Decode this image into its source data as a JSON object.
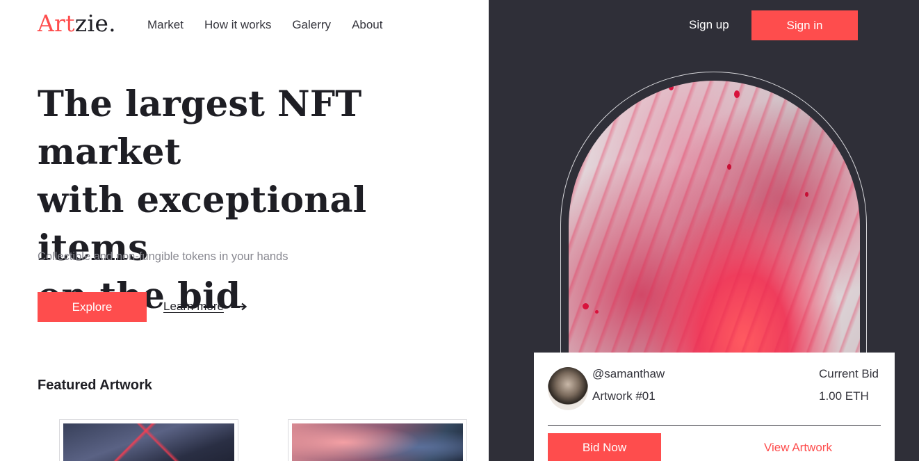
{
  "brand": {
    "logo_accent": "Art",
    "logo_rest": "zie."
  },
  "nav": {
    "items": [
      {
        "label": "Market"
      },
      {
        "label": "How it works"
      },
      {
        "label": "Galerry"
      },
      {
        "label": "About"
      }
    ]
  },
  "auth": {
    "signup_label": "Sign up",
    "signin_label": "Sign in"
  },
  "hero": {
    "title_line1": "The largest NFT market",
    "title_line2": "with exceptional items",
    "title_line3": "on the bid",
    "subtitle": "Collectible and non-fungible tokens in your hands",
    "explore_label": "Explore",
    "learn_more_label": "Learn more"
  },
  "featured": {
    "heading": "Featured Artwork"
  },
  "bid_card": {
    "username": "@samanthaw",
    "artwork_name": "Artwork #01",
    "current_bid_label": "Current Bid",
    "current_bid_value": "1.00 ETH",
    "bid_now_label": "Bid Now",
    "view_artwork_label": "View Artwork"
  },
  "colors": {
    "accent": "#fe4d4d",
    "dark_panel": "#2f2f38",
    "text": "#1e1e24",
    "muted": "#888890"
  },
  "icons": {
    "learn_more_arrow": "arrow-right-icon"
  }
}
